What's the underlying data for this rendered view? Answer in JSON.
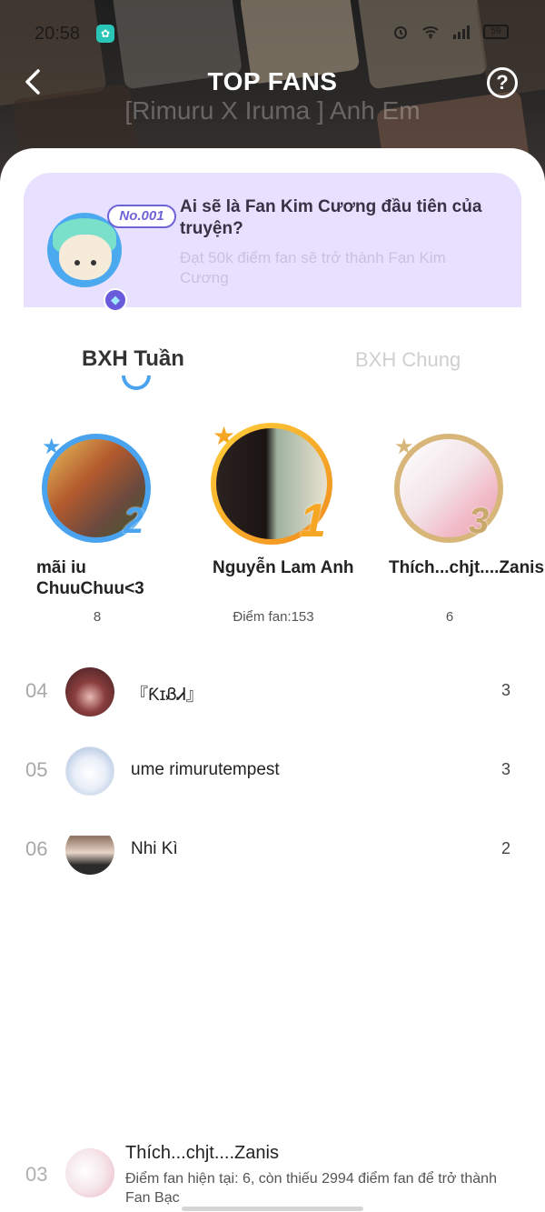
{
  "status_bar": {
    "time": "20:58",
    "battery": "59"
  },
  "header": {
    "title": "TOP FANS",
    "help_label": "?",
    "story_title": "[Rimuru X Iruma ] Anh Em"
  },
  "banner": {
    "badge": "No.001",
    "title": "Ai sẽ là Fan Kim Cương đầu tiên của truyện?",
    "subtitle": "Đạt 50k điểm fan sẽ trở thành Fan Kim Cương"
  },
  "tabs": [
    {
      "label": "BXH Tuần",
      "active": true
    },
    {
      "label": "BXH Chung",
      "active": false
    }
  ],
  "podium": [
    {
      "rank": "2",
      "name": "mãi iu ChuuChuu<3",
      "score": "8",
      "ring_color": "#4aa3ee"
    },
    {
      "rank": "1",
      "name": "Nguyễn Lam Anh",
      "score": "Điểm fan:153",
      "ring_color": "#f6a623"
    },
    {
      "rank": "3",
      "name": "Thích...chjt....Zanis",
      "score": "6",
      "ring_color": "#d8b67a"
    }
  ],
  "ranking": [
    {
      "rank": "04",
      "name": "『ƘɪᏰᏗ』",
      "score": "3"
    },
    {
      "rank": "05",
      "name": "ume rimurutempest",
      "score": "3"
    },
    {
      "rank": "06",
      "name": "Nhi Kì",
      "score": "2"
    }
  ],
  "my_rank": {
    "rank": "03",
    "name": "Thích...chjt....Zanis",
    "description": "Điểm fan hiện tại: 6, còn thiếu 2994 điểm fan để trở thành Fan Bạc"
  }
}
